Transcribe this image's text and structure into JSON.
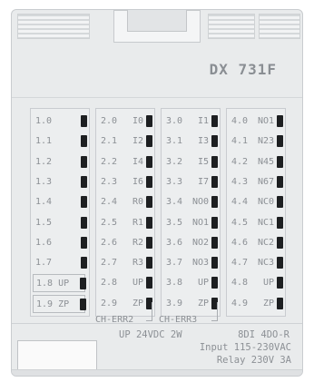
{
  "model": "DX 731F",
  "columns": [
    {
      "rows": [
        {
          "label": "1.0",
          "right": ""
        },
        {
          "label": "1.1",
          "right": ""
        },
        {
          "label": "1.2",
          "right": ""
        },
        {
          "label": "1.3",
          "right": ""
        },
        {
          "label": "1.4",
          "right": ""
        },
        {
          "label": "1.5",
          "right": ""
        },
        {
          "label": "1.6",
          "right": ""
        },
        {
          "label": "1.7",
          "right": ""
        },
        {
          "label": "1.8 UP",
          "right": "",
          "boxed": true
        },
        {
          "label": "1.9 ZP",
          "right": "",
          "boxed": true
        }
      ]
    },
    {
      "rows": [
        {
          "label": "2.0",
          "right": "I0"
        },
        {
          "label": "2.1",
          "right": "I2"
        },
        {
          "label": "2.2",
          "right": "I4"
        },
        {
          "label": "2.3",
          "right": "I6"
        },
        {
          "label": "2.4",
          "right": "R0"
        },
        {
          "label": "2.5",
          "right": "R1"
        },
        {
          "label": "2.6",
          "right": "R2"
        },
        {
          "label": "2.7",
          "right": "R3"
        },
        {
          "label": "2.8",
          "right": "UP"
        },
        {
          "label": "2.9",
          "right": "ZP"
        }
      ]
    },
    {
      "rows": [
        {
          "label": "3.0",
          "right": "I1"
        },
        {
          "label": "3.1",
          "right": "I3"
        },
        {
          "label": "3.2",
          "right": "I5"
        },
        {
          "label": "3.3",
          "right": "I7"
        },
        {
          "label": "3.4",
          "right": "NO0"
        },
        {
          "label": "3.5",
          "right": "NO1"
        },
        {
          "label": "3.6",
          "right": "NO2"
        },
        {
          "label": "3.7",
          "right": "NO3"
        },
        {
          "label": "3.8",
          "right": "UP"
        },
        {
          "label": "3.9",
          "right": "ZP"
        }
      ]
    },
    {
      "rows": [
        {
          "label": "4.0",
          "right": "NO1"
        },
        {
          "label": "4.1",
          "right": "N23"
        },
        {
          "label": "4.2",
          "right": "N45"
        },
        {
          "label": "4.3",
          "right": "N67"
        },
        {
          "label": "4.4",
          "right": "NC0"
        },
        {
          "label": "4.5",
          "right": "NC1"
        },
        {
          "label": "4.6",
          "right": "NC2"
        },
        {
          "label": "4.7",
          "right": "NC3"
        },
        {
          "label": "4.8",
          "right": "UP"
        },
        {
          "label": "4.9",
          "right": "ZP"
        }
      ]
    }
  ],
  "errors": {
    "ch2": "CH-ERR2",
    "ch3": "CH-ERR3"
  },
  "spec": {
    "power": "UP 24VDC 2W",
    "io": "8DI 4DO-R",
    "input": "Input 115-230VAC",
    "relay": "Relay 230V 3A"
  },
  "colors": {
    "body": "#e9ebec",
    "led": "#1d1f21",
    "text": "#8c9095"
  }
}
